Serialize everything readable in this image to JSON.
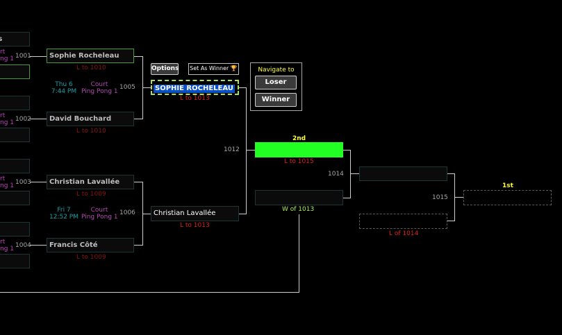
{
  "toolbar": {
    "options_label": "Options",
    "set_winner_label": "Set As Winner",
    "set_winner_icon": "trophy-icon"
  },
  "navigate": {
    "title": "Navigate to",
    "loser_label": "Loser",
    "winner_label": "Winner"
  },
  "left_clipped": {
    "top_frag": "is",
    "m1001_frag1": "rt",
    "m1001_frag2": "ng 1",
    "m1002_frag1": "rt",
    "m1002_frag2": "ng 1",
    "m1003_frag1": "rt",
    "m1003_frag2": "ng 1",
    "m1004_frag1": "rt",
    "m1004_frag2": "ng 1"
  },
  "matches": {
    "m1001": {
      "number": "1001"
    },
    "m1002": {
      "number": "1002"
    },
    "m1003": {
      "number": "1003"
    },
    "m1004": {
      "number": "1004"
    },
    "m1005": {
      "number": "1005",
      "day": "Thu 6",
      "time": "7:44 PM",
      "court": "Court",
      "court_name": "Ping Pong 1",
      "top_player": "Sophie Rocheleau",
      "top_note": "L to 1010",
      "bottom_player": "David Bouchard",
      "bottom_note": "L to 1010"
    },
    "m1006": {
      "number": "1006",
      "day": "Fri 7",
      "time": "12:52 PM",
      "court": "Court",
      "court_name": "Ping Pong 1",
      "top_player": "Christian Lavallée",
      "top_note": "L to 1009",
      "bottom_player": "Francis Côté",
      "bottom_note": "L to 1009"
    },
    "m1012": {
      "number": "1012",
      "top_player": "SOPHIE ROCHELEAU",
      "top_note": "L to 1013",
      "bottom_player": "Christian Lavallée",
      "bottom_note": "L to 1013"
    },
    "m1014": {
      "number": "1014",
      "place": "2nd",
      "top_note": "L to 1015",
      "bottom_note": "W of 1013"
    },
    "m1015": {
      "number": "1015",
      "place": "1st",
      "bottom_note": "L of 1014"
    }
  }
}
